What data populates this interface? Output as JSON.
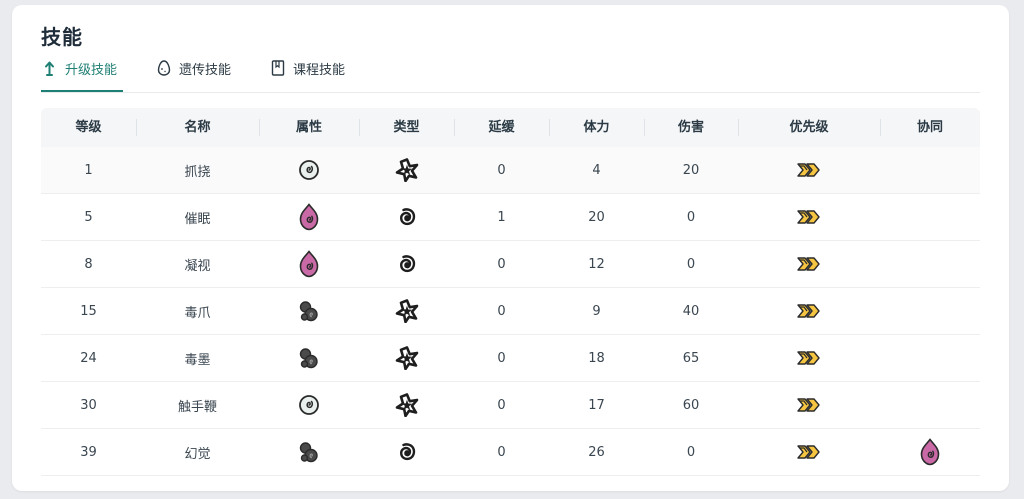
{
  "section_title": "技能",
  "tabs": [
    {
      "label": "升级技能",
      "icon": "arrow-up-icon",
      "active": true
    },
    {
      "label": "遗传技能",
      "icon": "egg-icon",
      "active": false
    },
    {
      "label": "课程技能",
      "icon": "book-icon",
      "active": false
    }
  ],
  "colors": {
    "accent": "#1e7f74",
    "psychic": "#c96aa6",
    "poison": "#4a4a4a",
    "normal": "#e9f0ee",
    "priority": "#f5c542"
  },
  "columns": [
    "等级",
    "名称",
    "属性",
    "类型",
    "延缓",
    "体力",
    "伤害",
    "优先级",
    "协同"
  ],
  "rows": [
    {
      "level": "1",
      "name": "抓挠",
      "attribute": "normal-swirl-icon",
      "type": "physical-star-icon",
      "delay": "0",
      "stamina": "4",
      "damage": "20",
      "priority": "priority-chevrons-icon",
      "synergy": ""
    },
    {
      "level": "5",
      "name": "催眠",
      "attribute": "psychic-flame-icon",
      "type": "status-spiral-icon",
      "delay": "1",
      "stamina": "20",
      "damage": "0",
      "priority": "priority-chevrons-icon",
      "synergy": ""
    },
    {
      "level": "8",
      "name": "凝视",
      "attribute": "psychic-flame-icon",
      "type": "status-spiral-icon",
      "delay": "0",
      "stamina": "12",
      "damage": "0",
      "priority": "priority-chevrons-icon",
      "synergy": ""
    },
    {
      "level": "15",
      "name": "毒爪",
      "attribute": "poison-bubbles-icon",
      "type": "physical-star-icon",
      "delay": "0",
      "stamina": "9",
      "damage": "40",
      "priority": "priority-chevrons-icon",
      "synergy": ""
    },
    {
      "level": "24",
      "name": "毒墨",
      "attribute": "poison-bubbles-icon",
      "type": "physical-star-icon",
      "delay": "0",
      "stamina": "18",
      "damage": "65",
      "priority": "priority-chevrons-icon",
      "synergy": ""
    },
    {
      "level": "30",
      "name": "触手鞭",
      "attribute": "normal-swirl-icon",
      "type": "physical-star-icon",
      "delay": "0",
      "stamina": "17",
      "damage": "60",
      "priority": "priority-chevrons-icon",
      "synergy": ""
    },
    {
      "level": "39",
      "name": "幻觉",
      "attribute": "poison-bubbles-icon",
      "type": "status-spiral-icon",
      "delay": "0",
      "stamina": "26",
      "damage": "0",
      "priority": "priority-chevrons-icon",
      "synergy": "psychic-flame-icon"
    }
  ]
}
